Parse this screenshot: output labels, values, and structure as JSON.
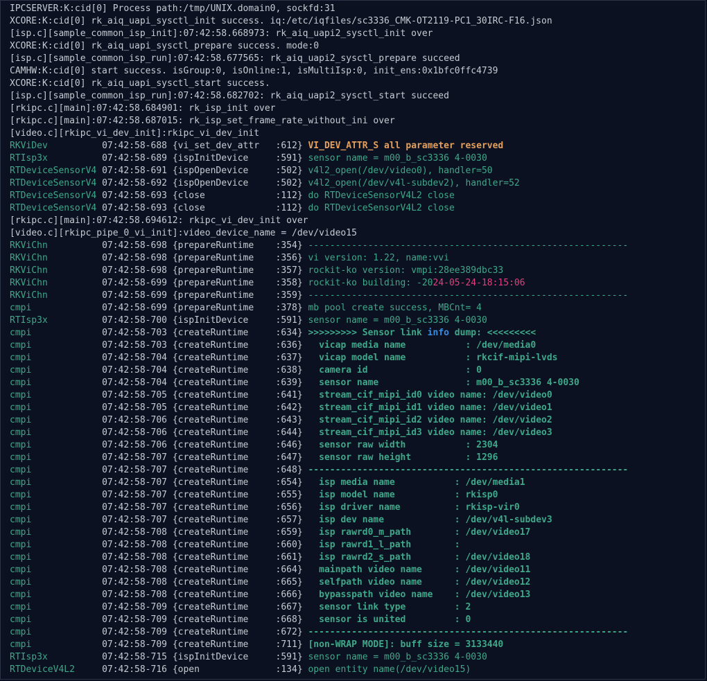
{
  "colors": {
    "background": "#0b1120",
    "default_text": "#c5ccd3",
    "tag_green": "#3fa88a",
    "warning_orange": "#e4a05c",
    "date_pink": "#e0407e",
    "info_blue": "#3b8bdf"
  },
  "lines": [
    {
      "type": "plain",
      "text": "IPCSERVER:K:cid[0] Process path:/tmp/UNIX.domain0, sockfd:31"
    },
    {
      "type": "plain",
      "text": "XCORE:K:cid[0] rk_aiq_uapi_sysctl_init success. iq:/etc/iqfiles/sc3336_CMK-OT2119-PC1_30IRC-F16.json"
    },
    {
      "type": "plain",
      "text": "[isp.c][sample_common_isp_init]:07:42:58.668973: rk_aiq_uapi2_sysctl_init over"
    },
    {
      "type": "plain",
      "text": "XCORE:K:cid[0] rk_aiq_uapi_sysctl_prepare success. mode:0"
    },
    {
      "type": "plain",
      "text": "[isp.c][sample_common_isp_run]:07:42:58.677565: rk_aiq_uapi2_sysctl_prepare succeed"
    },
    {
      "type": "plain",
      "text": "CAMHW:K:cid[0] start success. isGroup:0, isOnline:1, isMultiIsp:0, init_ens:0x1bfc0ffc4739"
    },
    {
      "type": "plain",
      "text": "XCORE:K:cid[0] rk_aiq_uapi_sysctl_start success."
    },
    {
      "type": "plain",
      "text": "[isp.c][sample_common_isp_run]:07:42:58.682702: rk_aiq_uapi2_sysctl_start succeed"
    },
    {
      "type": "plain",
      "text": "[rkipc.c][main]:07:42:58.684901: rk_isp_init over"
    },
    {
      "type": "plain",
      "text": "[rkipc.c][main]:07:42:58.687015: rk_isp_set_frame_rate_without_ini over"
    },
    {
      "type": "plain",
      "text": "[video.c][rkipc_vi_dev_init]:rkipc_vi_dev_init"
    },
    {
      "type": "log",
      "tag": "RKViDev          ",
      "ts": "07:42:58-688 ",
      "fn": "{vi_set_dev_attr   :612} ",
      "msg": "VI_DEV_ATTR_S all parameter reserved",
      "style": "warn"
    },
    {
      "type": "log",
      "tag": "RTIsp3x          ",
      "ts": "07:42:58-689 ",
      "fn": "{ispInitDevice     :591} ",
      "msg": "sensor name = m00_b_sc3336 4-0030",
      "style": "msg"
    },
    {
      "type": "log",
      "tag": "RTDeviceSensorV4 ",
      "ts": "07:42:58-691 ",
      "fn": "{ispOpenDevice     :502} ",
      "msg": "v4l2_open(/dev/video0), handler=50",
      "style": "msg"
    },
    {
      "type": "log",
      "tag": "RTDeviceSensorV4 ",
      "ts": "07:42:58-692 ",
      "fn": "{ispOpenDevice     :502} ",
      "msg": "v4l2_open(/dev/v4l-subdev2), handler=52",
      "style": "msg"
    },
    {
      "type": "log",
      "tag": "RTDeviceSensorV4 ",
      "ts": "07:42:58-693 ",
      "fn": "{close             :112} ",
      "msg": "do RTDeviceSensorV4L2 close",
      "style": "msg"
    },
    {
      "type": "log",
      "tag": "RTDeviceSensorV4 ",
      "ts": "07:42:58-693 ",
      "fn": "{close             :112} ",
      "msg": "do RTDeviceSensorV4L2 close",
      "style": "msg"
    },
    {
      "type": "plain",
      "text": "[rkipc.c][main]:07:42:58.694612: rkipc_vi_dev_init over"
    },
    {
      "type": "plain",
      "text": "[video.c][rkipc_pipe_0_vi_init]:video_device_name = /dev/video15"
    },
    {
      "type": "log",
      "tag": "RKViChn          ",
      "ts": "07:42:58-698 ",
      "fn": "{prepareRuntime    :354} ",
      "msg": "-----------------------------------------------------------",
      "style": "msg"
    },
    {
      "type": "log",
      "tag": "RKViChn          ",
      "ts": "07:42:58-698 ",
      "fn": "{prepareRuntime    :356} ",
      "msg": "vi version: 1.22, name:vvi",
      "style": "msg"
    },
    {
      "type": "log",
      "tag": "RKViChn          ",
      "ts": "07:42:58-698 ",
      "fn": "{prepareRuntime    :357} ",
      "msg": "rockit-ko version: vmpi:28ee389dbc33",
      "style": "msg"
    },
    {
      "type": "log",
      "tag": "RKViChn          ",
      "ts": "07:42:58-699 ",
      "fn": "{prepareRuntime    :358} ",
      "msg": "rockit-ko building: -20",
      "msg_pink": "24-05-24-18:15:06",
      "style": "msg"
    },
    {
      "type": "log",
      "tag": "RKViChn          ",
      "ts": "07:42:58-699 ",
      "fn": "{prepareRuntime    :359} ",
      "msg": "-----------------------------------------------------------",
      "style": "msg"
    },
    {
      "type": "log",
      "tag": "cmpi             ",
      "ts": "07:42:58-699 ",
      "fn": "{prepareRuntime    :378} ",
      "msg": "mb pool create success, MBCnt= 4",
      "style": "msg"
    },
    {
      "type": "log",
      "tag": "RTIsp3x          ",
      "ts": "07:42:58-700 ",
      "fn": "{ispInitDevice     :591} ",
      "msg": "sensor name = m00_b_sc3336 4-0030",
      "style": "msg"
    },
    {
      "type": "log",
      "tag": "cmpi             ",
      "ts": "07:42:58-703 ",
      "fn": "{createRuntime     :634} ",
      "msg": ">>>>>>>>> Sensor link ",
      "msg_info": "info",
      "msg_after": " dump: <<<<<<<<<",
      "style": "bold"
    },
    {
      "type": "log",
      "tag": "cmpi             ",
      "ts": "07:42:58-703 ",
      "fn": "{createRuntime     :636} ",
      "msg": "  vicap media name           : /dev/media0",
      "style": "bold"
    },
    {
      "type": "log",
      "tag": "cmpi             ",
      "ts": "07:42:58-704 ",
      "fn": "{createRuntime     :637} ",
      "msg": "  vicap model name           : rkcif-mipi-lvds",
      "style": "bold"
    },
    {
      "type": "log",
      "tag": "cmpi             ",
      "ts": "07:42:58-704 ",
      "fn": "{createRuntime     :638} ",
      "msg": "  camera id                  : 0",
      "style": "bold"
    },
    {
      "type": "log",
      "tag": "cmpi             ",
      "ts": "07:42:58-704 ",
      "fn": "{createRuntime     :639} ",
      "msg": "  sensor name                : m00_b_sc3336 4-0030",
      "style": "bold"
    },
    {
      "type": "log",
      "tag": "cmpi             ",
      "ts": "07:42:58-705 ",
      "fn": "{createRuntime     :641} ",
      "msg": "  stream_cif_mipi_id0 video name: /dev/video0",
      "style": "bold"
    },
    {
      "type": "log",
      "tag": "cmpi             ",
      "ts": "07:42:58-705 ",
      "fn": "{createRuntime     :642} ",
      "msg": "  stream_cif_mipi_id1 video name: /dev/video1",
      "style": "bold"
    },
    {
      "type": "log",
      "tag": "cmpi             ",
      "ts": "07:42:58-706 ",
      "fn": "{createRuntime     :643} ",
      "msg": "  stream_cif_mipi_id2 video name: /dev/video2",
      "style": "bold"
    },
    {
      "type": "log",
      "tag": "cmpi             ",
      "ts": "07:42:58-706 ",
      "fn": "{createRuntime     :644} ",
      "msg": "  stream_cif_mipi_id3 video name: /dev/video3",
      "style": "bold"
    },
    {
      "type": "log",
      "tag": "cmpi             ",
      "ts": "07:42:58-706 ",
      "fn": "{createRuntime     :646} ",
      "msg": "  sensor raw width           : 2304",
      "style": "bold"
    },
    {
      "type": "log",
      "tag": "cmpi             ",
      "ts": "07:42:58-707 ",
      "fn": "{createRuntime     :647} ",
      "msg": "  sensor raw height          : 1296",
      "style": "bold"
    },
    {
      "type": "log",
      "tag": "cmpi             ",
      "ts": "07:42:58-707 ",
      "fn": "{createRuntime     :648} ",
      "msg": "-----------------------------------------------------------",
      "style": "bold"
    },
    {
      "type": "log",
      "tag": "cmpi             ",
      "ts": "07:42:58-707 ",
      "fn": "{createRuntime     :654} ",
      "msg": "  isp media name           : /dev/media1",
      "style": "bold"
    },
    {
      "type": "log",
      "tag": "cmpi             ",
      "ts": "07:42:58-707 ",
      "fn": "{createRuntime     :655} ",
      "msg": "  isp model name           : rkisp0",
      "style": "bold"
    },
    {
      "type": "log",
      "tag": "cmpi             ",
      "ts": "07:42:58-707 ",
      "fn": "{createRuntime     :656} ",
      "msg": "  isp driver name          : rkisp-vir0",
      "style": "bold"
    },
    {
      "type": "log",
      "tag": "cmpi             ",
      "ts": "07:42:58-707 ",
      "fn": "{createRuntime     :657} ",
      "msg": "  isp dev name             : /dev/v4l-subdev3",
      "style": "bold"
    },
    {
      "type": "log",
      "tag": "cmpi             ",
      "ts": "07:42:58-708 ",
      "fn": "{createRuntime     :659} ",
      "msg": "  isp rawrd0_m_path        : /dev/video17",
      "style": "bold"
    },
    {
      "type": "log",
      "tag": "cmpi             ",
      "ts": "07:42:58-708 ",
      "fn": "{createRuntime     :660} ",
      "msg": "  isp rawrd1_l_path        :",
      "style": "bold"
    },
    {
      "type": "log",
      "tag": "cmpi             ",
      "ts": "07:42:58-708 ",
      "fn": "{createRuntime     :661} ",
      "msg": "  isp rawrd2_s_path        : /dev/video18",
      "style": "bold"
    },
    {
      "type": "log",
      "tag": "cmpi             ",
      "ts": "07:42:58-708 ",
      "fn": "{createRuntime     :664} ",
      "msg": "  mainpath video name      : /dev/video11",
      "style": "bold"
    },
    {
      "type": "log",
      "tag": "cmpi             ",
      "ts": "07:42:58-708 ",
      "fn": "{createRuntime     :665} ",
      "msg": "  selfpath video name      : /dev/video12",
      "style": "bold"
    },
    {
      "type": "log",
      "tag": "cmpi             ",
      "ts": "07:42:58-708 ",
      "fn": "{createRuntime     :666} ",
      "msg": "  bypasspath video name    : /dev/video13",
      "style": "bold"
    },
    {
      "type": "log",
      "tag": "cmpi             ",
      "ts": "07:42:58-709 ",
      "fn": "{createRuntime     :667} ",
      "msg": "  sensor link type         : 2",
      "style": "bold"
    },
    {
      "type": "log",
      "tag": "cmpi             ",
      "ts": "07:42:58-709 ",
      "fn": "{createRuntime     :668} ",
      "msg": "  sensor is united         : 0",
      "style": "bold"
    },
    {
      "type": "log",
      "tag": "cmpi             ",
      "ts": "07:42:58-709 ",
      "fn": "{createRuntime     :672} ",
      "msg": "-----------------------------------------------------------",
      "style": "bold"
    },
    {
      "type": "log",
      "tag": "cmpi             ",
      "ts": "07:42:58-709 ",
      "fn": "{createRuntime     :711} ",
      "msg": "[non-WRAP MODE]: buff size = 3133440",
      "style": "bold"
    },
    {
      "type": "log",
      "tag": "RTIsp3x          ",
      "ts": "07:42:58-715 ",
      "fn": "{ispInitDevice     :591} ",
      "msg": "sensor name = m00_b_sc3336 4-0030",
      "style": "msg"
    },
    {
      "type": "log",
      "tag": "RTDeviceV4L2     ",
      "ts": "07:42:58-716 ",
      "fn": "{open              :134} ",
      "msg": "open entity name(/dev/video15)",
      "style": "msg"
    }
  ]
}
